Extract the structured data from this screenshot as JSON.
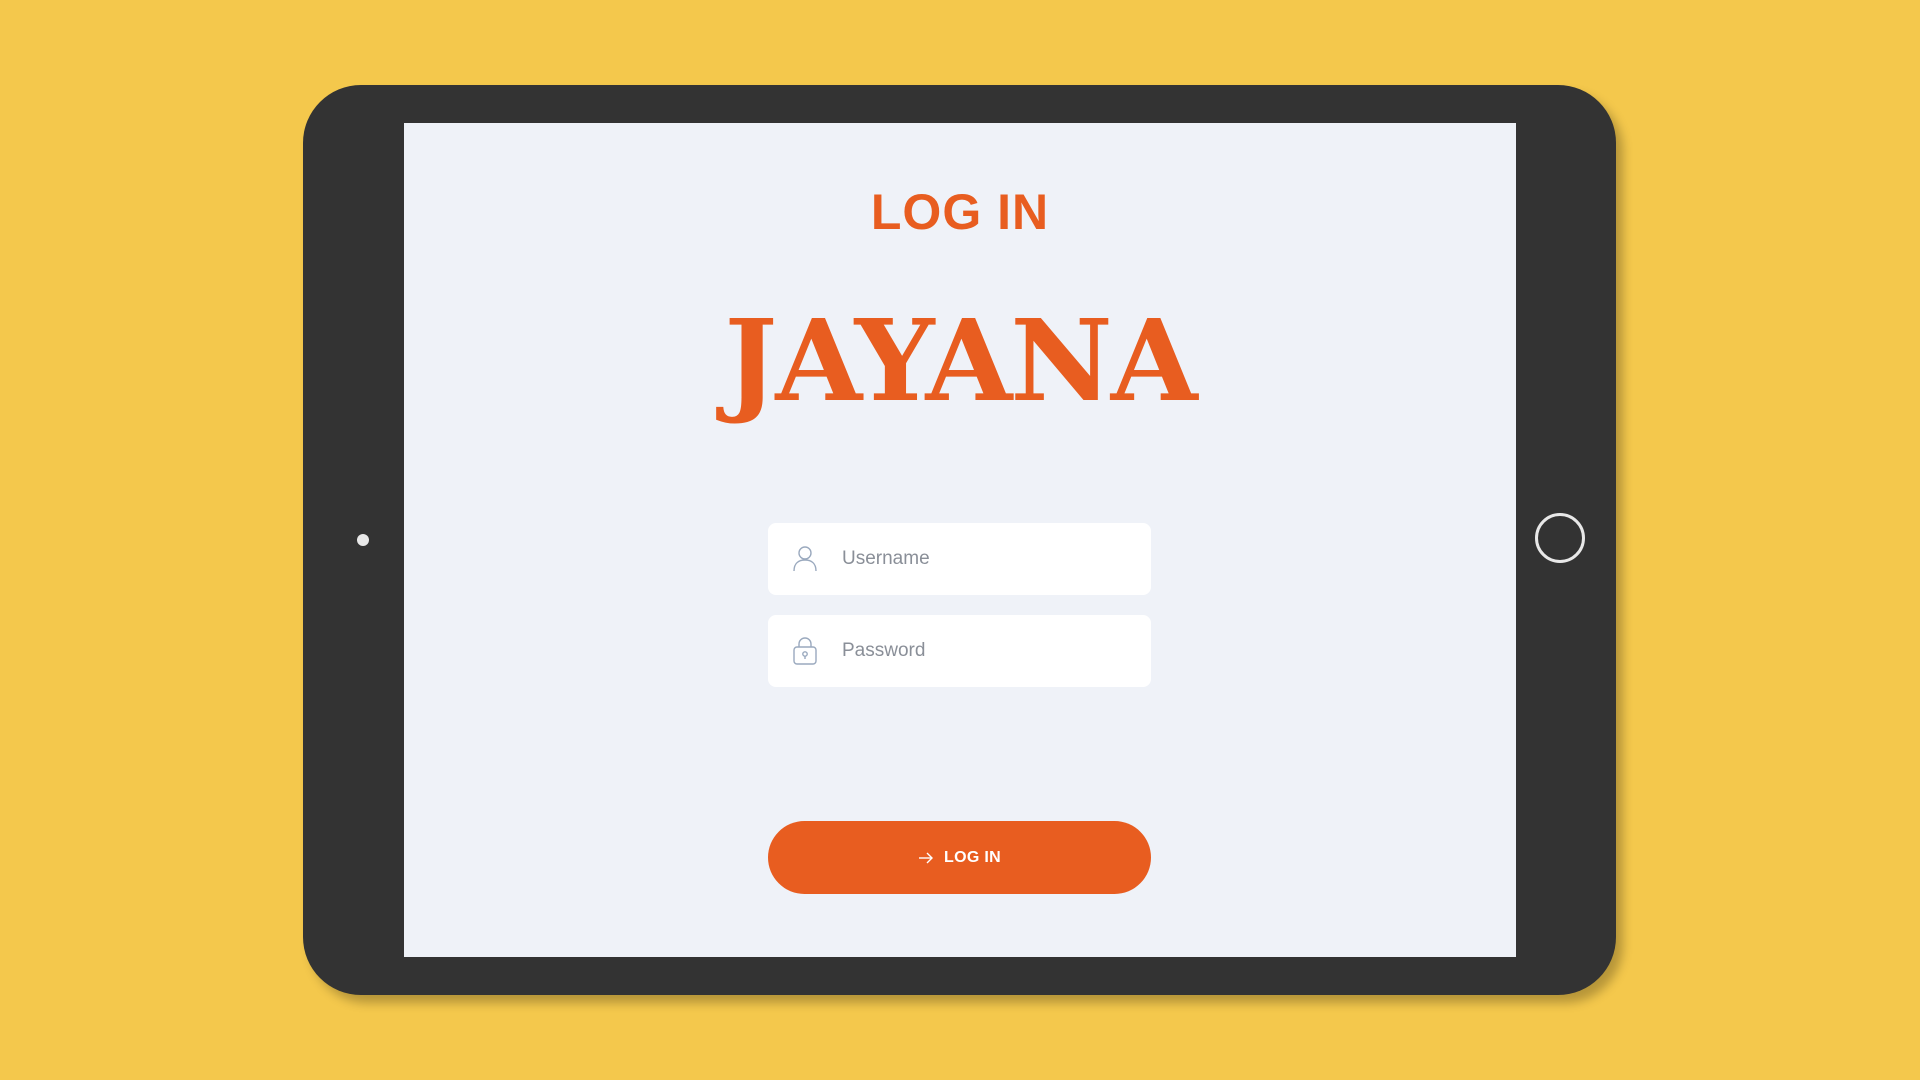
{
  "app": {
    "heading": "LOG IN",
    "brand": "JAYANA"
  },
  "form": {
    "username": {
      "placeholder": "Username",
      "value": "",
      "icon": "user-icon"
    },
    "password": {
      "placeholder": "Password",
      "value": "",
      "icon": "lock-icon"
    },
    "submit": {
      "label": "LOG IN",
      "icon": "arrow-right-icon"
    }
  },
  "colors": {
    "background": "#F4C84C",
    "device": "#333333",
    "screen": "#EFF2F8",
    "accent": "#E85D20",
    "field": "#FFFFFF"
  }
}
